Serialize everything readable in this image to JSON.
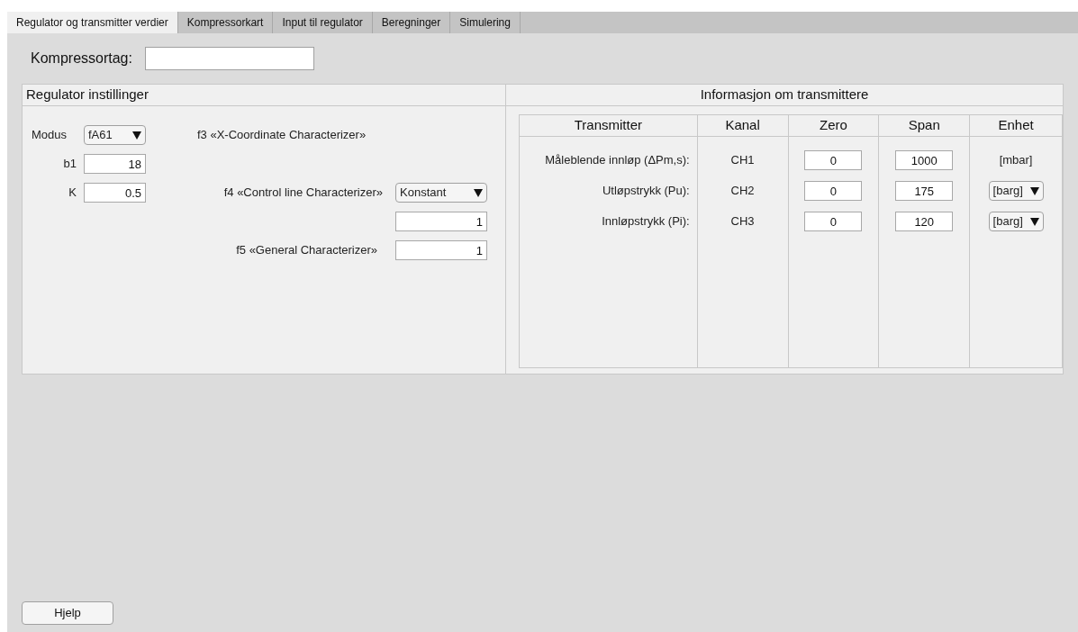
{
  "tabs": [
    {
      "label": "Regulator og transmitter verdier",
      "selected": true
    },
    {
      "label": "Kompressorkart",
      "selected": false
    },
    {
      "label": "Input til regulator",
      "selected": false
    },
    {
      "label": "Beregninger",
      "selected": false
    },
    {
      "label": "Simulering",
      "selected": false
    }
  ],
  "tag_field": {
    "label": "Kompressortag:"
  },
  "regulator_panel": {
    "title": "Regulator instillinger",
    "modus": {
      "label": "Modus",
      "value": "fA61"
    },
    "b1": {
      "label": "b1",
      "value": "18"
    },
    "k": {
      "label": "K",
      "value": "0.5"
    },
    "f3": {
      "label": "f3 «X-Coordinate Characterizer»"
    },
    "f4": {
      "label": "f4 «Control line Characterizer»",
      "value": "Konstant",
      "field_value": "1"
    },
    "f5": {
      "label": "f5 «General Characterizer»",
      "value": "1"
    }
  },
  "transmitter_panel": {
    "title": "Informasjon om transmittere",
    "columns": [
      "Transmitter",
      "Kanal",
      "Zero",
      "Span",
      "Enhet"
    ],
    "rows": [
      {
        "label": "Måleblende innløp (ΔPm,s):",
        "channel": "CH1",
        "zero": "0",
        "span": "1000",
        "unit": {
          "kind": "text",
          "value": "[mbar]"
        }
      },
      {
        "label": "Utløpstrykk (Pu):",
        "channel": "CH2",
        "zero": "0",
        "span": "175",
        "unit": {
          "kind": "dropdown",
          "value": "[barg]"
        }
      },
      {
        "label": "Innløpstrykk (Pi):",
        "channel": "CH3",
        "zero": "0",
        "span": "120",
        "unit": {
          "kind": "dropdown",
          "value": "[barg]"
        }
      }
    ]
  },
  "help_button": {
    "label": "Hjelp"
  }
}
